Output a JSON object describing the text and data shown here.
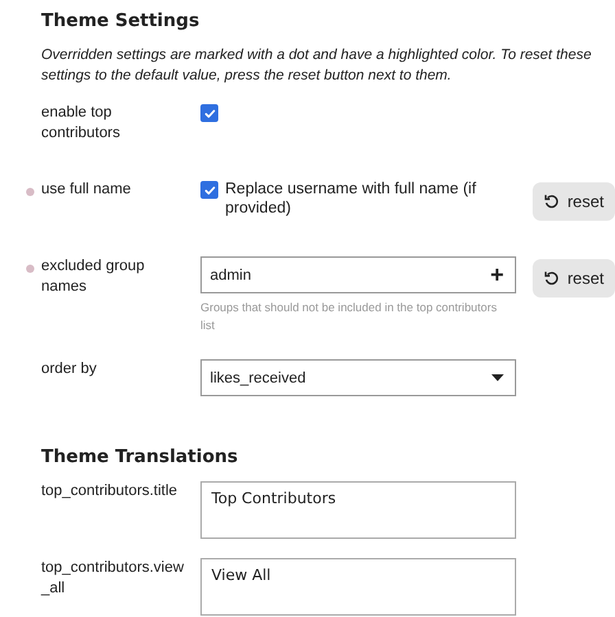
{
  "settings_title": "Theme Settings",
  "description": "Overridden settings are marked with a dot and have a highlighted color. To reset these settings to the default value, press the reset button next to them.",
  "settings": [
    {
      "kind": "checkbox",
      "label": "enable top contributors",
      "overridden": false,
      "checked": true
    },
    {
      "kind": "checkbox",
      "label": "use full name",
      "overridden": true,
      "checked": true,
      "option_text": "Replace username with full name (if provided)",
      "reset": "reset"
    },
    {
      "kind": "list",
      "label": "excluded group names",
      "overridden": true,
      "value": "admin",
      "add_icon": "+",
      "hint": "Groups that should not be included in the top contributors list",
      "reset": "reset"
    },
    {
      "kind": "select",
      "label": "order by",
      "overridden": false,
      "value": "likes_received"
    }
  ],
  "translations_title": "Theme Translations",
  "translations": [
    {
      "label": "top_contributors.title",
      "value": "Top Contributors"
    },
    {
      "label": "top_contributors.view_all",
      "value": "View All"
    }
  ]
}
